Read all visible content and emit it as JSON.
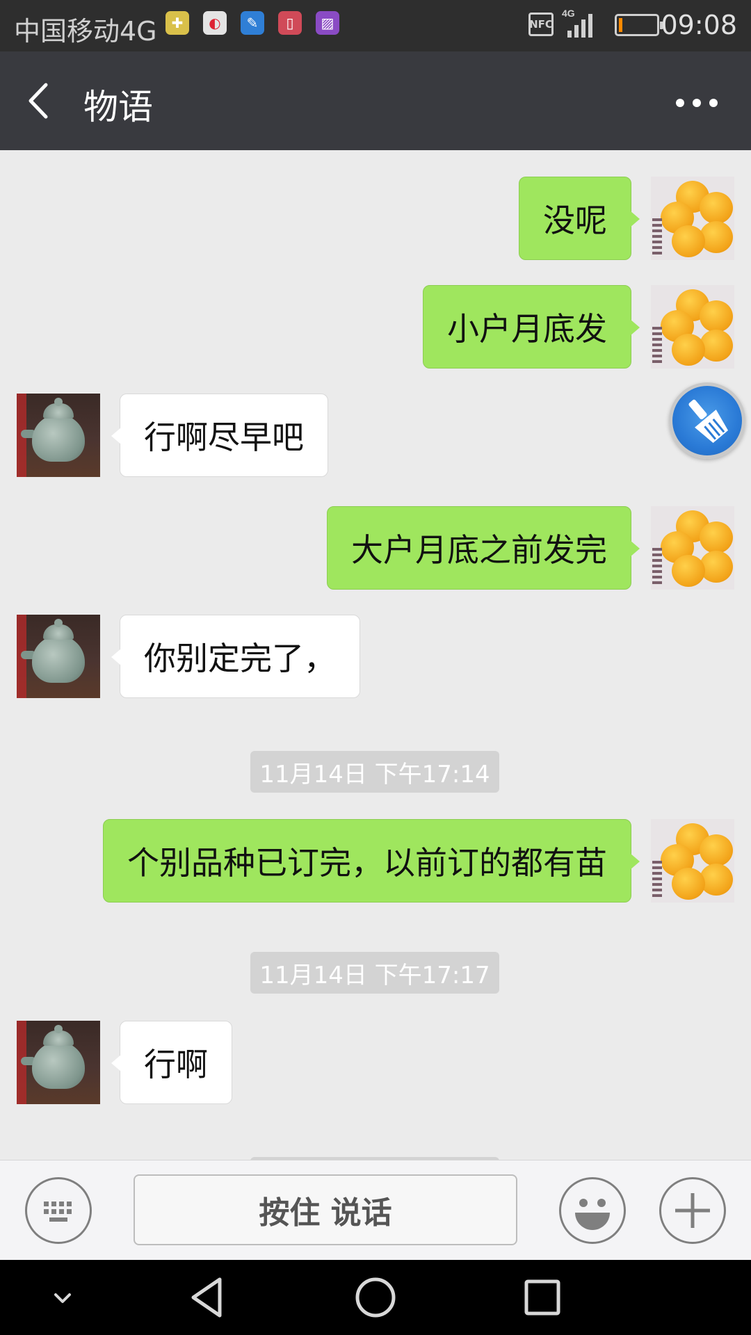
{
  "status_bar": {
    "carrier": "中国移动4G",
    "notification_icons": [
      "app-notification-icon",
      "browser-notification-icon",
      "cleaner-notification-icon",
      "power-notification-icon",
      "gallery-notification-icon"
    ],
    "nfc_label": "NFC",
    "network": "4G",
    "battery_level": 0.05,
    "time": "09:08"
  },
  "title_bar": {
    "back_icon": "chevron-left-icon",
    "title": "物语",
    "more_icon": "more-dots-icon"
  },
  "messages": [
    {
      "direction": "out",
      "text": "没呢"
    },
    {
      "direction": "out",
      "text": "小户月底发"
    },
    {
      "direction": "in",
      "text": "行啊尽早吧"
    },
    {
      "direction": "out",
      "text": "大户月底之前发完"
    },
    {
      "direction": "in",
      "text": "你别定完了，"
    },
    {
      "type": "timestamp",
      "text": "11月14日 下午17:14"
    },
    {
      "direction": "out",
      "text": "个别品种已订完，以前订的都有苗"
    },
    {
      "type": "timestamp",
      "text": "11月14日 下午17:17"
    },
    {
      "direction": "in",
      "text": "行啊"
    }
  ],
  "floating_ball_icon": "broom-icon",
  "input_bar": {
    "keyboard_icon": "keyboard-icon",
    "hold_to_talk_label": "按住 说话",
    "emoji_icon": "emoji-icon",
    "plus_icon": "plus-icon"
  },
  "nav_bar": {
    "icons": [
      "chevron-down-icon",
      "back-triangle-icon",
      "home-circle-icon",
      "recents-square-icon"
    ]
  },
  "colors": {
    "outgoing_bubble": "#9fe65e",
    "incoming_bubble": "#ffffff",
    "chat_background": "#ebebeb",
    "title_bar": "#393a3f"
  }
}
